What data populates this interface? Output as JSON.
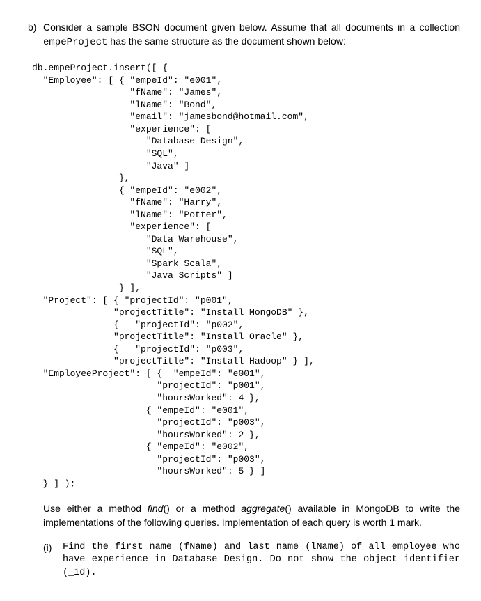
{
  "question": {
    "label": "b)",
    "intro_part1": "Consider a sample BSON document given below. Assume that all documents in a collection ",
    "intro_code": "empeProject",
    "intro_part2": " has the same structure as the document shown below:"
  },
  "code": "db.empeProject.insert([ {\n  \"Employee\": [ { \"empeId\": \"e001\",\n                  \"fName\": \"James\",\n                  \"lName\": \"Bond\",\n                  \"email\": \"jamesbond@hotmail.com\",\n                  \"experience\": [\n                     \"Database Design\",\n                     \"SQL\",\n                     \"Java\" ]\n                },\n                { \"empeId\": \"e002\",\n                  \"fName\": \"Harry\",\n                  \"lName\": \"Potter\",\n                  \"experience\": [\n                     \"Data Warehouse\",\n                     \"SQL\",\n                     \"Spark Scala\",\n                     \"Java Scripts\" ]\n                } ],\n  \"Project\": [ { \"projectId\": \"p001\",\n               \"projectTitle\": \"Install MongoDB\" },\n               {   \"projectId\": \"p002\",\n               \"projectTitle\": \"Install Oracle\" },\n               {   \"projectId\": \"p003\",\n               \"projectTitle\": \"Install Hadoop\" } ],\n  \"EmployeeProject\": [ {  \"empeId\": \"e001\",\n                       \"projectId\": \"p001\",\n                       \"hoursWorked\": 4 },\n                     { \"empeId\": \"e001\",\n                       \"projectId\": \"p003\",\n                       \"hoursWorked\": 2 },\n                     { \"empeId\": \"e002\",\n                       \"projectId\": \"p003\",\n                       \"hoursWorked\": 5 } ]\n  } ] );",
  "instruction": {
    "part1": "Use either a method ",
    "method1": "find",
    "paren1": "()",
    "mid": " or a method ",
    "method2": "aggregate",
    "paren2": "()",
    "part2": " available in MongoDB to write the implementations of the following queries. Implementation of each query is worth 1 mark."
  },
  "subquestion": {
    "label": "(i)",
    "text": "Find the first name (fName) and last name (lName) of all employee who have experience in Database Design. Do not show the object identifier (_id)."
  }
}
